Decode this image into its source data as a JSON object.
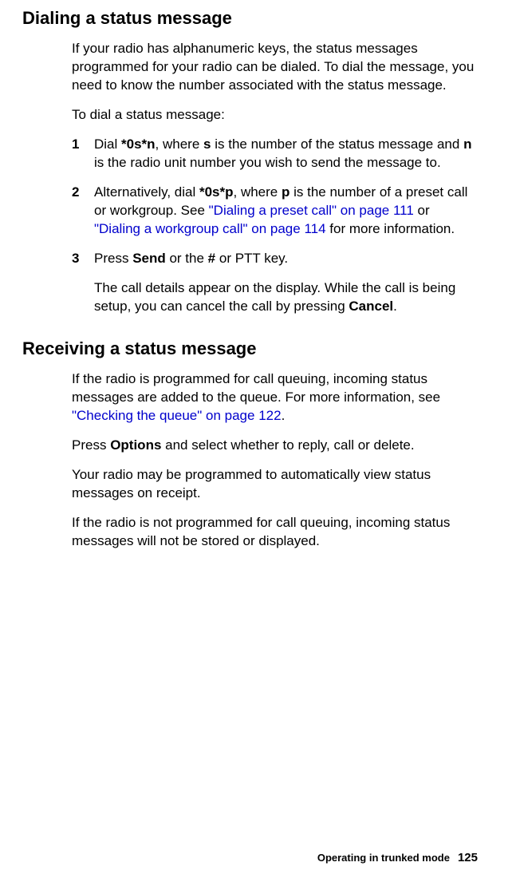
{
  "section1": {
    "heading": "Dialing a status message",
    "p1": "If your radio has alphanumeric keys, the status messages programmed for your radio can be dialed. To dial the message, you need to know the number associated with the status message.",
    "p2": "To dial a status message:",
    "step1": {
      "num": "1",
      "t1": "Dial ",
      "b1": "*0s*n",
      "t2": ", where ",
      "b2": "s",
      "t3": " is the number of the status message and ",
      "b3": "n",
      "t4": " is the radio unit number you wish to send the message to."
    },
    "step2": {
      "num": "2",
      "t1": "Alternatively, dial ",
      "b1": "*0s*p",
      "t2": ", where ",
      "b2": "p",
      "t3": " is the number of a preset call or workgroup. See ",
      "l1": "\"Dialing a preset call\" on page 111",
      "t4": " or ",
      "l2": "\"Dialing a workgroup call\" on page 114",
      "t5": " for more information."
    },
    "step3": {
      "num": "3",
      "t1": "Press ",
      "b1": "Send",
      "t2": " or the ",
      "b2": "#",
      "t3": " or PTT key."
    },
    "sub": {
      "t1": "The call details appear on the display. While the call is being setup, you can cancel the call by pressing ",
      "b1": "Cancel",
      "t2": "."
    }
  },
  "section2": {
    "heading": "Receiving a status message",
    "p1": {
      "t1": "If the radio is programmed for call queuing, incoming status messages are added to the queue. For more information, see ",
      "l1": "\"Checking the queue\" on page 122",
      "t2": "."
    },
    "p2": {
      "t1": "Press ",
      "b1": "Options",
      "t2": " and select whether to reply, call or delete."
    },
    "p3": "Your radio may be programmed to automatically view status messages on receipt.",
    "p4": "If the radio is not programmed for call queuing, incoming status messages will not be stored or displayed."
  },
  "footer": {
    "text": "Operating in trunked mode",
    "page": "125"
  }
}
